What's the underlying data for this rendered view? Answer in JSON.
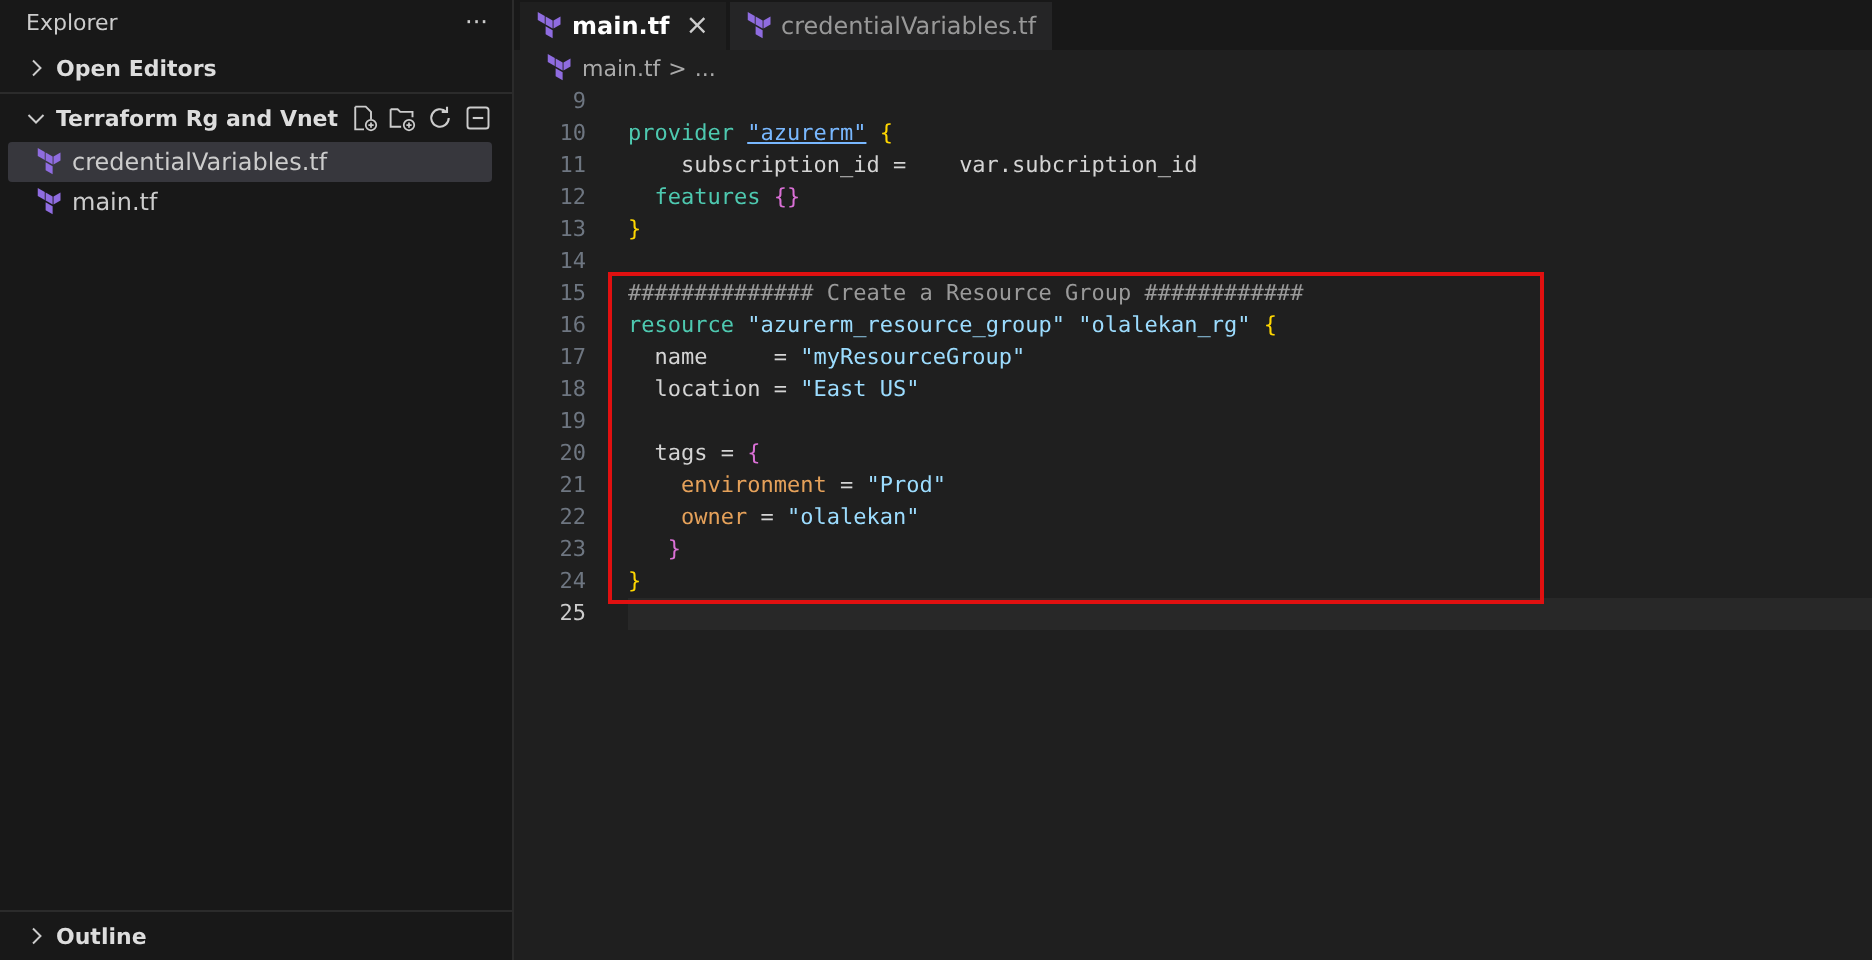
{
  "sidebar": {
    "title": "Explorer",
    "more": "···",
    "sections": [
      {
        "label": "Open Editors",
        "expanded": false
      },
      {
        "label": "Terraform Rg and Vnet",
        "expanded": true,
        "files": [
          {
            "name": "credentialVariables.tf",
            "selected": true
          },
          {
            "name": "main.tf",
            "selected": false
          }
        ]
      }
    ],
    "outline": {
      "label": "Outline",
      "expanded": false
    }
  },
  "tabs": [
    {
      "label": "main.tf",
      "selected": true,
      "close": "×"
    },
    {
      "label": "credentialVariables.tf",
      "selected": false
    }
  ],
  "breadcrumb": {
    "file": "main.tf",
    "separator": ">",
    "rest": "..."
  },
  "code": {
    "blocks": [
      {
        "kind": "plain",
        "lines": [
          {
            "number": "9"
          },
          {
            "number": "10",
            "tokens": [
              {
                "kind": "keyword",
                "text": "provider "
              },
              {
                "kind": "link",
                "text": "\"azurerm\""
              },
              {
                "kind": "brace",
                "text": " {"
              }
            ]
          },
          {
            "number": "11",
            "tokens": [
              {
                "kind": "plain",
                "text": "    subscription_id =    var.subcription_id"
              }
            ]
          },
          {
            "number": "12",
            "tokens": [
              {
                "kind": "keyword",
                "text": "  features "
              },
              {
                "kind": "brace2",
                "text": "{}"
              }
            ]
          },
          {
            "number": "13",
            "tokens": [
              {
                "kind": "brace",
                "text": "}"
              }
            ]
          },
          {
            "number": "14"
          }
        ]
      },
      {
        "kind": "highlight",
        "lines": [
          {
            "number": "15",
            "tokens": [
              {
                "kind": "comment",
                "text": "############## Create a Resource Group ############"
              }
            ]
          },
          {
            "number": "16",
            "tokens": [
              {
                "kind": "keyword",
                "text": "resource "
              },
              {
                "kind": "string",
                "text": "\"azurerm_resource_group\" \"olalekan_rg\""
              },
              {
                "kind": "brace",
                "text": " {"
              }
            ]
          },
          {
            "number": "17",
            "tokens": [
              {
                "kind": "plain",
                "text": "  name     = "
              },
              {
                "kind": "string",
                "text": "\"myResourceGroup\""
              }
            ]
          },
          {
            "number": "18",
            "tokens": [
              {
                "kind": "plain",
                "text": "  location = "
              },
              {
                "kind": "string",
                "text": "\"East US\""
              }
            ]
          },
          {
            "number": "19"
          },
          {
            "number": "20",
            "tokens": [
              {
                "kind": "plain",
                "text": "  tags = "
              },
              {
                "kind": "brace2",
                "text": "{"
              }
            ]
          },
          {
            "number": "21",
            "tokens": [
              {
                "kind": "property",
                "text": "    environment"
              },
              {
                "kind": "plain",
                "text": " = "
              },
              {
                "kind": "string",
                "text": "\"Prod\""
              }
            ]
          },
          {
            "number": "22",
            "tokens": [
              {
                "kind": "property",
                "text": "    owner"
              },
              {
                "kind": "plain",
                "text": " = "
              },
              {
                "kind": "string",
                "text": "\"olalekan\""
              }
            ]
          },
          {
            "number": "23",
            "tokens": [
              {
                "kind": "brace2",
                "text": "   }"
              }
            ]
          },
          {
            "number": "24",
            "tokens": [
              {
                "kind": "brace",
                "text": "}"
              }
            ]
          }
        ]
      },
      {
        "kind": "plain",
        "lines": [
          {
            "number": "25",
            "current": true
          }
        ]
      }
    ]
  }
}
